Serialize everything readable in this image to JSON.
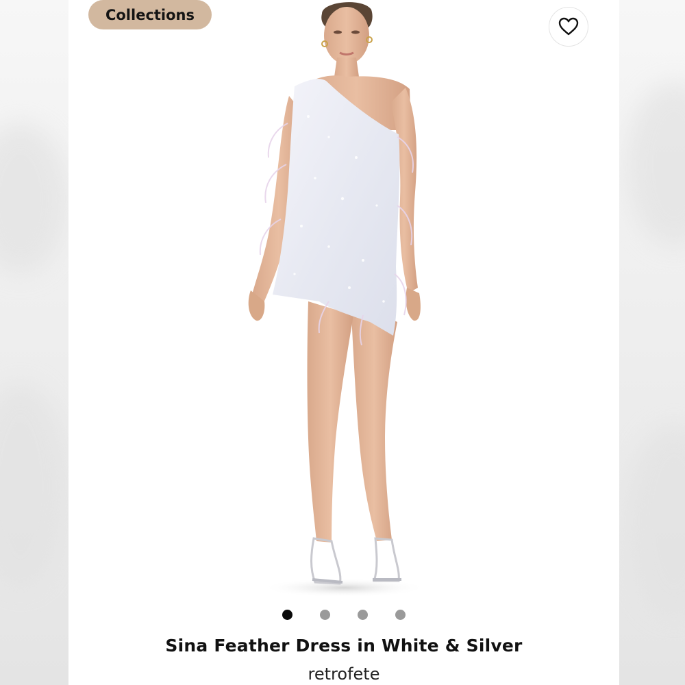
{
  "header": {
    "collections_label": "Collections",
    "favorite_icon": "heart-outline-icon"
  },
  "gallery": {
    "image_subject": "model-in-one-shoulder-feather-mini-dress",
    "dot_count": 4,
    "active_index": 0
  },
  "product": {
    "title": "Sina Feather Dress in White & Silver",
    "brand": "retrofete"
  },
  "colors": {
    "pill": "#d2b89f",
    "active_dot": "#0a0a0a",
    "inactive_dot": "#9a9a9a"
  }
}
